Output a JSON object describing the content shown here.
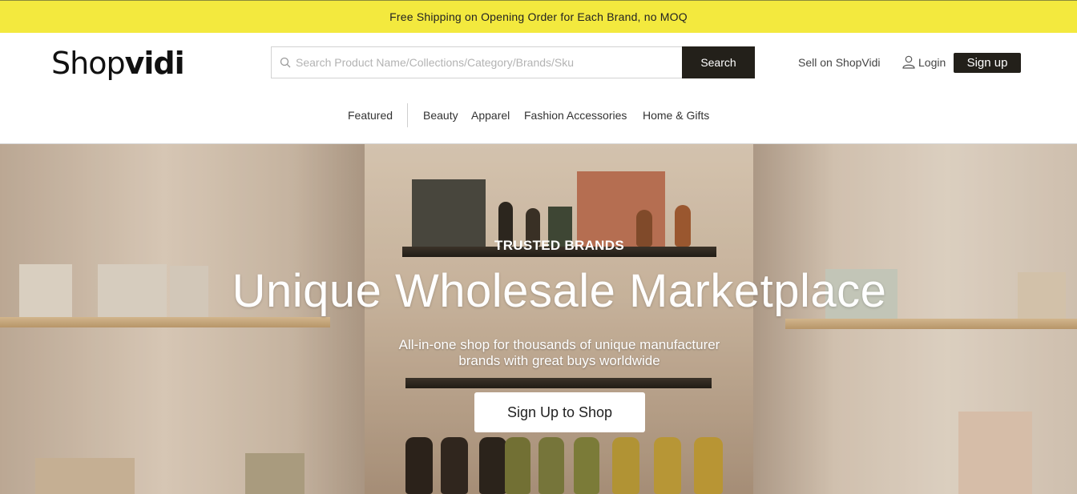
{
  "promo": {
    "text": "Free Shipping on Opening Order for Each Brand, no MOQ"
  },
  "header": {
    "logo": {
      "part1": "Shop",
      "part2": "vidi"
    },
    "search": {
      "placeholder": "Search Product Name/Collections/Category/Brands/Sku",
      "value": "",
      "button_label": "Search"
    },
    "sell_link": "Sell on ShopVidi",
    "login_label": "Login",
    "signup_label": "Sign up"
  },
  "nav": {
    "items": [
      {
        "label": "Featured"
      },
      {
        "label": "Beauty"
      },
      {
        "label": "Apparel"
      },
      {
        "label": "Fashion Accessories"
      },
      {
        "label": "Home & Gifts"
      }
    ]
  },
  "hero": {
    "eyebrow": "TRUSTED BRANDS",
    "title": "Unique Wholesale Marketplace",
    "subtitle": "All-in-one shop for thousands of unique manufacturer brands with great buys worldwide",
    "cta_label": "Sign Up to Shop"
  },
  "colors": {
    "promo_bg": "#f3e93e",
    "dark_button": "#23201a",
    "hero_text": "#ffffff"
  },
  "icons": {
    "search": "search-icon",
    "user": "user-icon"
  }
}
